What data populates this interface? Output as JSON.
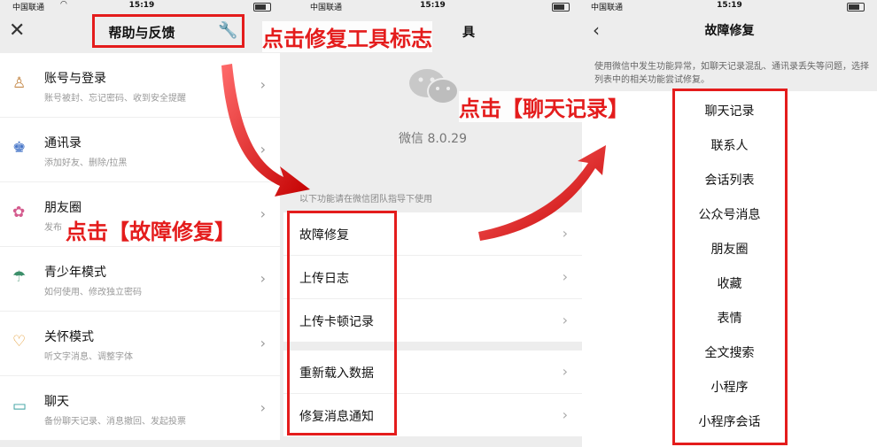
{
  "status": {
    "carrier": "中国联通",
    "time": "15:19"
  },
  "panel1": {
    "title": "帮助与反馈",
    "items": [
      {
        "title": "账号与登录",
        "subtitle": "账号被封、忘记密码、收到安全提醒"
      },
      {
        "title": "通讯录",
        "subtitle": "添加好友、删除/拉黑"
      },
      {
        "title": "朋友圈",
        "subtitle": "发布"
      },
      {
        "title": "青少年模式",
        "subtitle": "如何使用、修改独立密码"
      },
      {
        "title": "关怀模式",
        "subtitle": "听文字消息、调整字体"
      },
      {
        "title": "聊天",
        "subtitle": "备份聊天记录、消息撤回、发起投票"
      }
    ],
    "annotation": "点击【故障修复】"
  },
  "panel2": {
    "annotation_top": "点击修复工具标志",
    "title_fragment": "具",
    "version": "微信 8.0.29",
    "hint": "以下功能请在微信团队指导下使用",
    "group1": [
      "故障修复",
      "上传日志",
      "上传卡顿记录"
    ],
    "group2": [
      "重新载入数据",
      "修复消息通知"
    ],
    "annotation": "点击【聊天记录】"
  },
  "panel3": {
    "title": "故障修复",
    "description": "使用微信中发生功能异常，如聊天记录混乱、通讯录丢失等问题，选择列表中的相关功能尝试修复。",
    "items": [
      "聊天记录",
      "联系人",
      "会话列表",
      "公众号消息",
      "朋友圈",
      "收藏",
      "表情",
      "全文搜索",
      "小程序",
      "小程序会话"
    ]
  },
  "colors": {
    "annotation": "#e41c1c",
    "background": "#ededed"
  },
  "icons": [
    "close-icon",
    "wrench-icon",
    "chevron-right-icon",
    "back-icon",
    "wechat-logo"
  ]
}
